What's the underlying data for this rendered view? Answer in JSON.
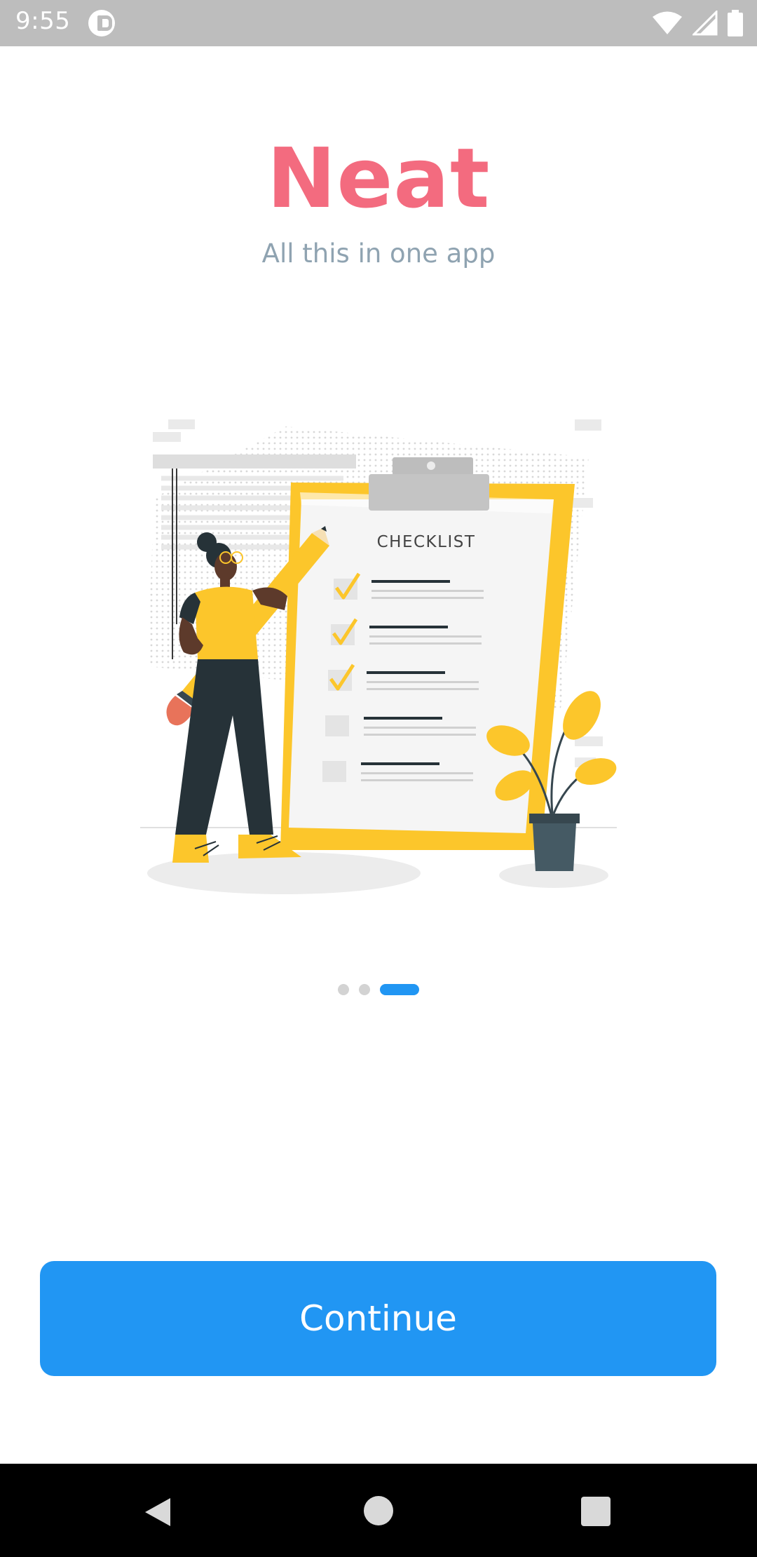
{
  "status_bar": {
    "time": "9:55",
    "icons": [
      "app-notification-icon",
      "wifi-icon",
      "cellular-signal-icon",
      "battery-icon"
    ]
  },
  "header": {
    "title": "Neat",
    "subtitle": "All this in one app"
  },
  "illustration": {
    "clipboard_heading": "CHECKLIST",
    "checklist_items_checked": [
      true,
      true,
      true,
      false,
      false
    ]
  },
  "pager": {
    "pages": 3,
    "current_page": 3
  },
  "continue_button": {
    "label": "Continue"
  },
  "nav_bar": {
    "icons": [
      "back-icon",
      "home-icon",
      "recents-icon"
    ]
  },
  "colors": {
    "title": "#f36b7f",
    "subtitle": "#8fa3b1",
    "accent": "#2196f3",
    "illustration_yellow": "#fcc62b",
    "status_bar": "#bdbdbd"
  }
}
